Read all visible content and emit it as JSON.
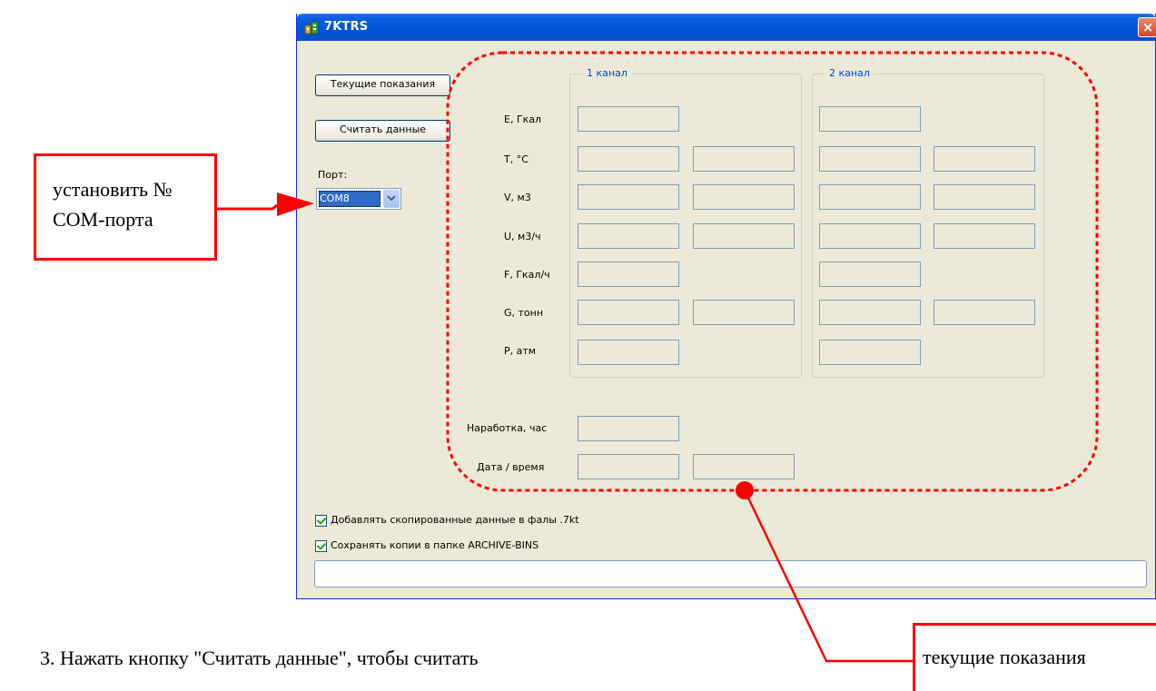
{
  "window": {
    "title": "7KTRS",
    "close_glyph": "×"
  },
  "buttons": {
    "current_readings": "Текущие показания",
    "read_data": "Считать данные"
  },
  "port": {
    "label": "Порт:",
    "selected": "COM8",
    "arrow_glyph": "⌄"
  },
  "channels": {
    "channel1_title": "1 канал",
    "channel2_title": "2 канал"
  },
  "rows": [
    {
      "label": "E, Гкал",
      "fields_per_channel": 1
    },
    {
      "label": "T, °C",
      "fields_per_channel": 2
    },
    {
      "label": "V, м3",
      "fields_per_channel": 2
    },
    {
      "label": "U, м3/ч",
      "fields_per_channel": 2
    },
    {
      "label": "F, Гкал/ч",
      "fields_per_channel": 1
    },
    {
      "label": "G, тонн",
      "fields_per_channel": 2
    },
    {
      "label": "P, атм",
      "fields_per_channel": 1
    }
  ],
  "extra": {
    "runtime_label": "Наработка, час",
    "datetime_label": "Дата / время"
  },
  "checkboxes": [
    {
      "label": "Добавлять скопированные данные в фалы .7kt",
      "checked": true
    },
    {
      "label": "Сохранять копии в папке ARCHIVE-BINS",
      "checked": true
    }
  ],
  "progress": {
    "value": 0
  },
  "annotations": {
    "port_callout_line1": "установить №",
    "port_callout_line2": "COM-порта",
    "readings_callout": "текущие показания",
    "accent_color": "#ff0000"
  },
  "document": {
    "step_text": "3.   Нажать кнопку \"Считать данные\", чтобы считать"
  }
}
